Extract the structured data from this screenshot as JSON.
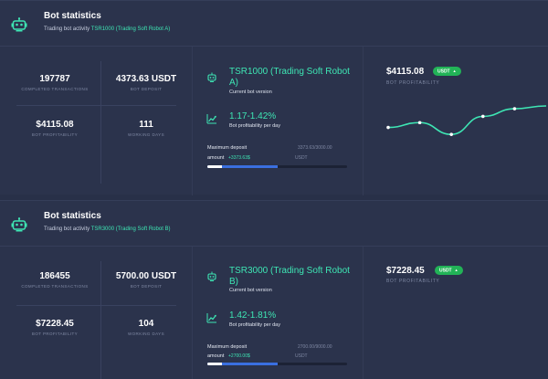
{
  "colors": {
    "accent": "#3ee6b4",
    "badge": "#22b357",
    "progress": "#3a6fe0",
    "background": "#283048"
  },
  "cards": [
    {
      "title": "Bot statistics",
      "subtitle_prefix": "Trading bot activity",
      "subtitle_bot": "TSR1000 (Trading Soft Robot A)",
      "stats": [
        {
          "value": "197787",
          "label": "COMPLETED TRANSACTIONS"
        },
        {
          "value": "4373.63 USDT",
          "label": "BOT DEPOSIT"
        },
        {
          "value": "$4115.08",
          "label": "BOT PROFITABILITY"
        },
        {
          "value": "111",
          "label": "WORKING DAYS"
        }
      ],
      "bot_name": "TSR1000 (Trading Soft Robot A)",
      "bot_version_label": "Current bot version",
      "profit_range": "1.17-1.42%",
      "profit_range_label": "Bot profitability per day",
      "max_deposit_label": "Maximum deposit",
      "max_deposit_value": "3373.63/3000.00",
      "amount_label": "amount",
      "amount_value": "+3373.63$",
      "currency": "USDT",
      "progress": 0.5,
      "profitability": "$4115.08",
      "badge": "USDT",
      "profitability_label": "BOT PROFITABILITY",
      "spark": [
        0.62,
        0.48,
        0.82,
        0.3,
        0.08,
        0.0
      ]
    },
    {
      "title": "Bot statistics",
      "subtitle_prefix": "Trading bot activity",
      "subtitle_bot": "TSR3000 (Trading Soft Robot B)",
      "stats": [
        {
          "value": "186455",
          "label": "COMPLETED TRANSACTIONS"
        },
        {
          "value": "5700.00 USDT",
          "label": "BOT DEPOSIT"
        },
        {
          "value": "$7228.45",
          "label": "BOT PROFITABILITY"
        },
        {
          "value": "104",
          "label": "WORKING DAYS"
        }
      ],
      "bot_name": "TSR3000 (Trading Soft Robot B)",
      "bot_version_label": "Current bot version",
      "profit_range": "1.42-1.81%",
      "profit_range_label": "Bot profitability per day",
      "max_deposit_label": "Maximum deposit",
      "max_deposit_value": "2700.00/9000.00",
      "amount_label": "amount",
      "amount_value": "+2700.00$",
      "currency": "USDT",
      "progress": 0.5,
      "profitability": "$7228.45",
      "badge": "USDT",
      "profitability_label": "BOT PROFITABILITY"
    }
  ]
}
